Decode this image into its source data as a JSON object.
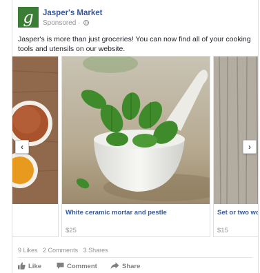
{
  "post": {
    "page_name": "Jasper's Market",
    "logo_letter": "g",
    "sponsored_label": "Sponsored",
    "separator": "·",
    "caption": "Jasper's is more than just groceries! You can now find all of your cooking tools and utensils on our website.",
    "colors": {
      "brand_green": "#3b7d35",
      "link_blue": "#365899",
      "meta_gray": "#90949c"
    }
  },
  "carousel": {
    "cards": [
      {
        "title": "",
        "price": ""
      },
      {
        "title": "White ceramic mortar and pestle",
        "price": "$25"
      },
      {
        "title": "Set or two wooden spoons",
        "price": "$15"
      }
    ],
    "prev_icon": "chevron-left-icon",
    "next_icon": "chevron-right-icon"
  },
  "stats": {
    "likes": "9 Likes",
    "comments": "2 Comments",
    "shares": "3 Shares"
  },
  "actions": {
    "like": "Like",
    "comment": "Comment",
    "share": "Share"
  }
}
